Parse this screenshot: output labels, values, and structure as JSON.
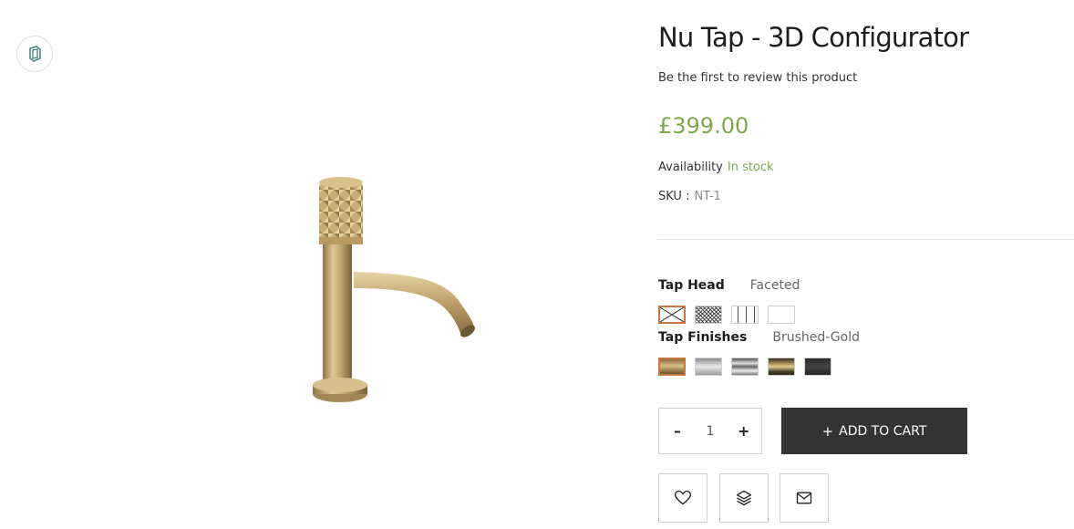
{
  "product": {
    "title": "Nu Tap - 3D Configurator",
    "review_link": "Be the first to review this product",
    "price": "£399.00",
    "availability_label": "Availability",
    "availability_value": "In stock",
    "sku_label": "SKU :",
    "sku_value": "NT-1",
    "image_icon": "gold-tap-image"
  },
  "options": {
    "tap_head": {
      "label": "Tap Head",
      "selected": "Faceted",
      "swatches": [
        "faceted",
        "knurled-mesh",
        "lines",
        "plain"
      ]
    },
    "tap_finishes": {
      "label": "Tap Finishes",
      "selected": "Brushed-Gold",
      "swatches": [
        "brushed-gold",
        "brushed-nickel",
        "chrome",
        "gold-black",
        "matte-black"
      ]
    }
  },
  "cart": {
    "quantity": "1",
    "minus": "–",
    "plus": "+",
    "add_plus": "+",
    "add_label": "ADD TO CART"
  },
  "actions": [
    "heart-icon",
    "layers-icon",
    "mail-icon"
  ],
  "colors": {
    "accent_green": "#7ea94a",
    "button_dark": "#333333",
    "selected_border": "#c8763c"
  }
}
